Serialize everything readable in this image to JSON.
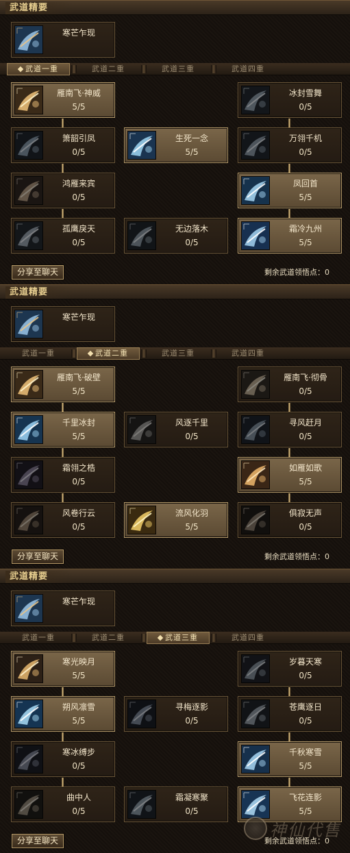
{
  "ui": {
    "share_label": "分享至聊天",
    "remaining_label": "剩余武道领悟点：",
    "header_title": "武道精要"
  },
  "tab_labels": [
    "武道一重",
    "武道二重",
    "武道三重",
    "武道四重"
  ],
  "panels": [
    {
      "header_title": "武道精要",
      "essence": {
        "name": "寒芒乍现",
        "icon": "frost-blade-icon"
      },
      "active_tab": 0,
      "remaining": "0",
      "skills": [
        {
          "name": "雁南飞·神威",
          "count": "5/5",
          "learned": true,
          "icon": "flying-goose-icon"
        },
        {
          "name": "冰封雪舞",
          "count": "0/5",
          "learned": false,
          "icon": "ice-dance-icon"
        },
        {
          "name": "箫韶引凤",
          "count": "0/5",
          "learned": false,
          "icon": "crescent-phoenix-icon"
        },
        {
          "name": "生死一念",
          "count": "5/5",
          "learned": true,
          "icon": "life-death-icon"
        },
        {
          "name": "万翎千机",
          "count": "0/5",
          "learned": false,
          "icon": "feather-blade-icon"
        },
        {
          "name": "鸿雁来宾",
          "count": "0/5",
          "learned": false,
          "icon": "wild-goose-icon"
        },
        {
          "name": "凤回首",
          "count": "5/5",
          "learned": true,
          "icon": "phoenix-return-icon"
        },
        {
          "name": "孤鹰戾天",
          "count": "0/5",
          "learned": false,
          "icon": "lone-eagle-icon"
        },
        {
          "name": "无边落木",
          "count": "0/5",
          "learned": false,
          "icon": "falling-leaves-icon"
        },
        {
          "name": "霜冷九州",
          "count": "5/5",
          "learned": true,
          "icon": "frost-realm-icon"
        }
      ]
    },
    {
      "header_title": "武道精要",
      "essence": {
        "name": "寒芒乍现",
        "icon": "frost-blade-icon"
      },
      "active_tab": 1,
      "remaining": "0",
      "skills": [
        {
          "name": "雁南飞·破壁",
          "count": "5/5",
          "learned": true,
          "icon": "flying-goose-icon"
        },
        {
          "name": "雁南飞·彻骨",
          "count": "0/5",
          "learned": false,
          "icon": "flying-goose-icon"
        },
        {
          "name": "千里冰封",
          "count": "5/5",
          "learned": true,
          "icon": "ice-seal-icon"
        },
        {
          "name": "风逐千里",
          "count": "0/5",
          "learned": false,
          "icon": "wind-chaser-icon"
        },
        {
          "name": "寻风赶月",
          "count": "0/5",
          "learned": false,
          "icon": "moon-chase-icon"
        },
        {
          "name": "霜翎之梏",
          "count": "0/5",
          "learned": false,
          "icon": "frost-feather-icon"
        },
        {
          "name": "如雁如歌",
          "count": "5/5",
          "learned": true,
          "icon": "goose-song-icon"
        },
        {
          "name": "风卷行云",
          "count": "0/5",
          "learned": false,
          "icon": "wind-cloud-icon"
        },
        {
          "name": "流风化羽",
          "count": "5/5",
          "learned": true,
          "icon": "wind-feather-icon"
        },
        {
          "name": "俱寂无声",
          "count": "0/5",
          "learned": false,
          "icon": "silence-icon"
        }
      ]
    },
    {
      "header_title": "武道精要",
      "essence": {
        "name": "寒芒乍现",
        "icon": "frost-blade-icon"
      },
      "active_tab": 2,
      "remaining": "0",
      "skills": [
        {
          "name": "寒光映月",
          "count": "5/5",
          "learned": true,
          "icon": "cold-moon-icon"
        },
        {
          "name": "岁暮天寒",
          "count": "0/5",
          "learned": false,
          "icon": "winter-dusk-icon"
        },
        {
          "name": "朔风凛雪",
          "count": "5/5",
          "learned": true,
          "icon": "north-wind-icon"
        },
        {
          "name": "寻梅逐影",
          "count": "0/5",
          "learned": false,
          "icon": "plum-shadow-icon"
        },
        {
          "name": "苍鹰逐日",
          "count": "0/5",
          "learned": false,
          "icon": "eagle-sun-icon"
        },
        {
          "name": "寒冰缚步",
          "count": "0/5",
          "learned": false,
          "icon": "ice-bind-icon"
        },
        {
          "name": "千秋寒雪",
          "count": "5/5",
          "learned": true,
          "icon": "eternal-snow-icon"
        },
        {
          "name": "曲中人",
          "count": "0/5",
          "learned": false,
          "icon": "melody-icon"
        },
        {
          "name": "霜凝寒聚",
          "count": "0/5",
          "learned": false,
          "icon": "frost-gather-icon"
        },
        {
          "name": "飞花连影",
          "count": "5/5",
          "learned": true,
          "icon": "flying-flower-icon"
        }
      ]
    }
  ],
  "watermark": {
    "text": "神仙代售"
  },
  "colors": {
    "gold": "#c7ae78",
    "learned_bg": "#6b5a41",
    "dim_bg": "#2a2017",
    "accent": "#f2dfae"
  }
}
